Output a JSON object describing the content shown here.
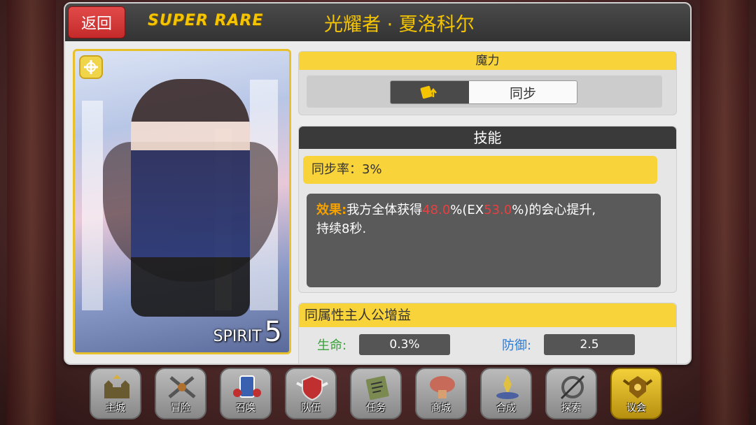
{
  "header": {
    "back_label": "返回",
    "rarity": "SUPER RARE",
    "character_name": "光耀者 · 夏洛科尔"
  },
  "card": {
    "attribute_icon": "cross-emblem-icon",
    "spirit_label": "SPIRIT",
    "spirit_value": "5"
  },
  "mana": {
    "title": "魔力",
    "toggle_icon": "magic-up-icon",
    "toggle_label": "同步"
  },
  "skill": {
    "title": "技能",
    "sync_rate_label": "同步率：",
    "sync_rate_value": "3%",
    "effect_label": "效果:",
    "effect_text_1": "我方全体获得",
    "effect_value_1": "48.0",
    "effect_text_2": "%(EX",
    "effect_value_2": "53.0",
    "effect_text_3": "%)的会心提升,",
    "effect_text_4": "持续8秒."
  },
  "bonus": {
    "title": "同属性主人公增益",
    "hp_label": "生命:",
    "hp_value": "0.3%",
    "def_label": "防御:",
    "def_value": "2.5"
  },
  "nav": {
    "items": [
      {
        "label": "主城",
        "icon": "castle-icon"
      },
      {
        "label": "冒险",
        "icon": "crossed-swords-icon"
      },
      {
        "label": "召唤",
        "icon": "summon-cards-icon"
      },
      {
        "label": "队伍",
        "icon": "team-shield-icon"
      },
      {
        "label": "任务",
        "icon": "quest-scroll-icon"
      },
      {
        "label": "商城",
        "icon": "shop-mushroom-icon"
      },
      {
        "label": "合成",
        "icon": "crystal-synth-icon"
      },
      {
        "label": "探索",
        "icon": "compass-explore-icon"
      },
      {
        "label": "议会",
        "icon": "council-crest-icon"
      }
    ]
  },
  "colors": {
    "accent_yellow": "#f8d33a",
    "rarity_gold": "#f4c400",
    "back_red": "#d43a3a",
    "effect_orange": "#f4a000",
    "effect_red": "#e84040",
    "hp_green": "#3aa03a",
    "def_blue": "#2a7ad8"
  }
}
